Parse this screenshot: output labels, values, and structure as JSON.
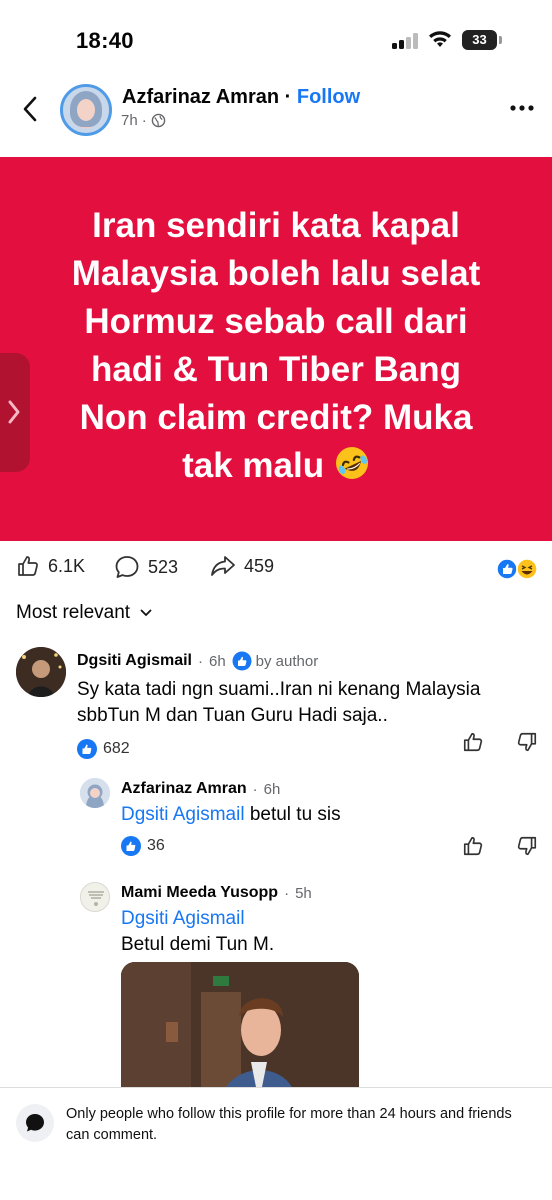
{
  "status": {
    "time": "18:40",
    "battery": "33"
  },
  "header": {
    "author": "Azfarinaz Amran",
    "separator": " · ",
    "follow": "Follow",
    "time": "7h",
    "visibility_icon": "globe-icon"
  },
  "post": {
    "text": "Iran sendiri kata kapal\nMalaysia boleh lalu selat\nHormuz sebab call dari\nhadi & Tun  Tiber Bang\nNon claim credit? Muka\ntak malu",
    "emoji": "rolling-on-floor-laughing",
    "background": "#e3103f"
  },
  "actions": {
    "likes": "6.1K",
    "comments": "523",
    "shares": "459"
  },
  "sort": {
    "label": "Most relevant"
  },
  "comments": [
    {
      "name": "Dgsiti Agismail",
      "time": "6h",
      "badge": "by author",
      "text": "Sy kata tadi ngn suami..Iran ni kenang Malaysia sbbTun M dan Tuan Guru Hadi saja..",
      "likes": "682"
    },
    {
      "name": "Azfarinaz Amran",
      "time": "6h",
      "mention": "Dgsiti Agismail",
      "text": "betul tu sis",
      "likes": "36"
    },
    {
      "name": "Mami Meeda Yusopp",
      "time": "5h",
      "mention": "Dgsiti Agismail",
      "text": "Betul demi Tun M."
    }
  ],
  "footer": {
    "text": "Only people who follow this profile for more than 24 hours and friends can comment."
  },
  "colors": {
    "accent": "#1877f2",
    "post_bg": "#e3103f"
  }
}
